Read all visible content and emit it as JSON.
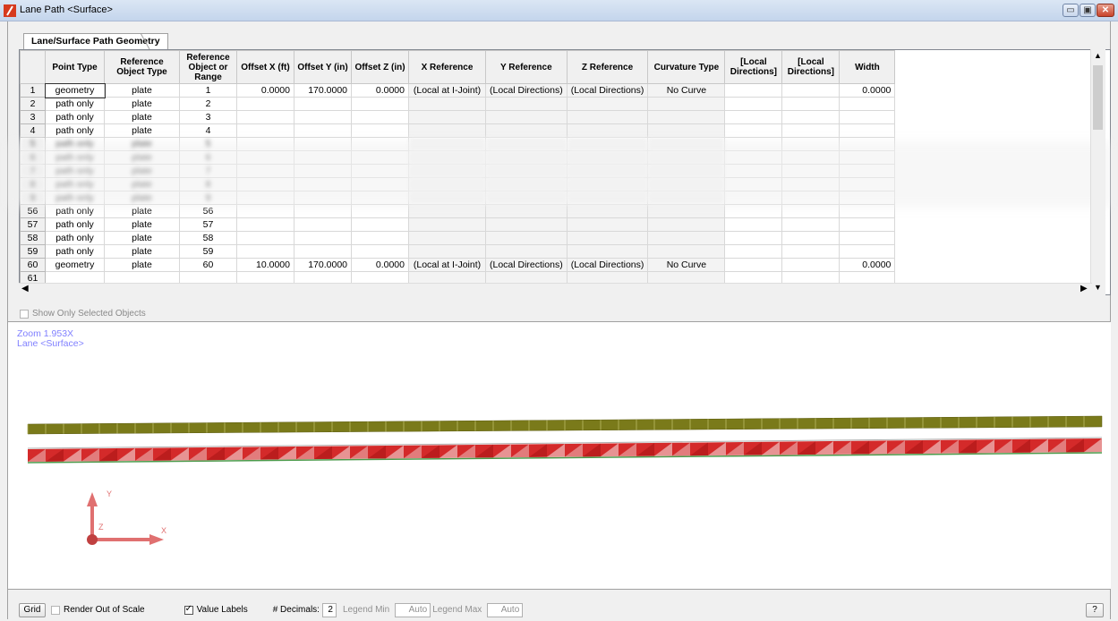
{
  "window": {
    "title": "Lane Path <Surface>",
    "btn_min": "▭",
    "btn_max": "▣",
    "btn_close": "✕"
  },
  "tab": {
    "label": "Lane/Surface Path Geometry"
  },
  "table": {
    "headers": [
      "Point Type",
      "Reference Object Type",
      "Reference Object or Range",
      "Offset X (ft)",
      "Offset Y (in)",
      "Offset Z (in)",
      "X Reference",
      "Y Reference",
      "Z Reference",
      "Curvature Type",
      "[Local Directions]",
      "[Local Directions]",
      "Width"
    ],
    "rows": [
      {
        "n": "1",
        "type": "geometry",
        "obj": "plate",
        "range": "1",
        "ox": "0.0000",
        "oy": "170.0000",
        "oz": "0.0000",
        "xr": "(Local at I-Joint)",
        "yr": "(Local Directions)",
        "zr": "(Local Directions)",
        "curv": "No Curve",
        "w": "0.0000"
      },
      {
        "n": "2",
        "type": "path only",
        "obj": "plate",
        "range": "2"
      },
      {
        "n": "3",
        "type": "path only",
        "obj": "plate",
        "range": "3"
      },
      {
        "n": "4",
        "type": "path only",
        "obj": "plate",
        "range": "4"
      },
      {
        "n": "5",
        "type": "path only",
        "obj": "plate",
        "range": "5"
      },
      {
        "n": "6",
        "type": "path only",
        "obj": "plate",
        "range": "6"
      },
      {
        "n": "7",
        "type": "path only",
        "obj": "plate",
        "range": "7"
      },
      {
        "n": "8",
        "type": "path only",
        "obj": "plate",
        "range": "8"
      },
      {
        "n": "9",
        "type": "path only",
        "obj": "plate",
        "range": "9"
      },
      {
        "n": "56",
        "type": "path only",
        "obj": "plate",
        "range": "56"
      },
      {
        "n": "57",
        "type": "path only",
        "obj": "plate",
        "range": "57"
      },
      {
        "n": "58",
        "type": "path only",
        "obj": "plate",
        "range": "58"
      },
      {
        "n": "59",
        "type": "path only",
        "obj": "plate",
        "range": "59"
      },
      {
        "n": "60",
        "type": "geometry",
        "obj": "plate",
        "range": "60",
        "ox": "10.0000",
        "oy": "170.0000",
        "oz": "0.0000",
        "xr": "(Local at I-Joint)",
        "yr": "(Local Directions)",
        "zr": "(Local Directions)",
        "curv": "No Curve",
        "w": "0.0000"
      },
      {
        "n": "61"
      }
    ]
  },
  "show_only_selected": "Show Only Selected Objects",
  "view": {
    "zoom": "Zoom  1.953X",
    "label": "Lane <Surface>",
    "axis_y": "Y",
    "axis_z": "Z",
    "axis_x": "X"
  },
  "bottom": {
    "grid": "Grid",
    "render_out": "Render Out of Scale",
    "value_labels": "Value Labels",
    "decimals_label": "# Decimals:",
    "decimals_value": "2",
    "legend_min_label": "Legend Min",
    "legend_min_value": "Auto",
    "legend_max_label": "Legend Max",
    "legend_max_value": "Auto",
    "help": "?"
  },
  "colors": {
    "lane_olive": "#7a7a1a",
    "surface_red": "#d42a2a",
    "axis": "#e07070",
    "zoom_text": "#8080ff"
  }
}
